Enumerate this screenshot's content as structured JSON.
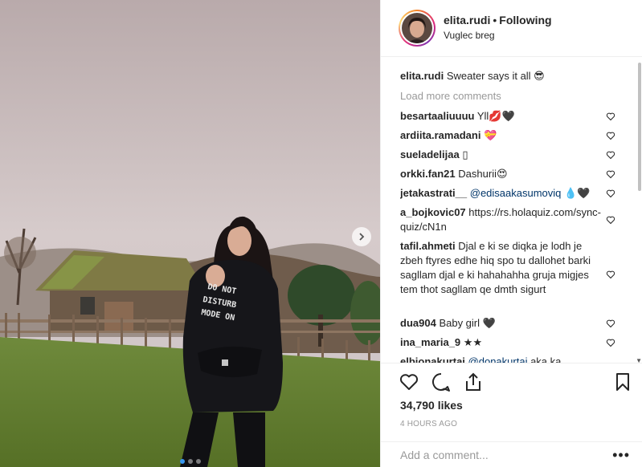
{
  "post": {
    "username": "elita.rudi",
    "separator": "•",
    "follow_status": "Following",
    "location": "Vuglec breg",
    "caption_user": "elita.rudi",
    "caption_text": "Sweater says it all 😎",
    "photo_sweater_text": [
      "DO NOT",
      "DISTURB",
      "MODE ON"
    ]
  },
  "comments": {
    "load_more": "Load more comments",
    "items": [
      {
        "user": "besartaaliuuuu",
        "text": "Yll💋🖤"
      },
      {
        "user": "ardiita.ramadani",
        "text": "💝"
      },
      {
        "user": "sueladelijaa",
        "text": "▯"
      },
      {
        "user": "orkki.fan21",
        "text": "Dashurii😍"
      },
      {
        "user": "jetakastrati__",
        "mention": "@edisaakasumoviq",
        "text": "💧🖤"
      },
      {
        "user": "a_bojkovic07",
        "text": "https://rs.holaquiz.com/sync-quiz/cN1n"
      },
      {
        "user": "tafil.ahmeti",
        "text": "Djal e ki se diqka je lodh je zbeh ftyres edhe hiq spo tu dallohet barki sagllam djal e ki hahahahha gruja migjes tem thot sagllam qe dmth sigurt"
      },
      {
        "user": "dua904",
        "text": "Baby girl 🖤"
      },
      {
        "user": "ina_maria_9",
        "text": "★★"
      },
      {
        "user": "elbionakurtai",
        "mention": "@donakurtai",
        "text": "aka ka"
      }
    ]
  },
  "stats": {
    "likes": "34,790 likes",
    "time": "4 HOURS AGO"
  },
  "add_comment": {
    "placeholder": "Add a comment...",
    "more": "•••"
  },
  "icons": {
    "like": "heart-icon",
    "comment": "comment-icon",
    "share": "share-icon",
    "save": "bookmark-icon",
    "next": "chevron-right-icon"
  },
  "colors": {
    "accent": "#3897f0",
    "text": "#262626",
    "muted": "#999999",
    "mention": "#003569",
    "border": "#efefef"
  }
}
